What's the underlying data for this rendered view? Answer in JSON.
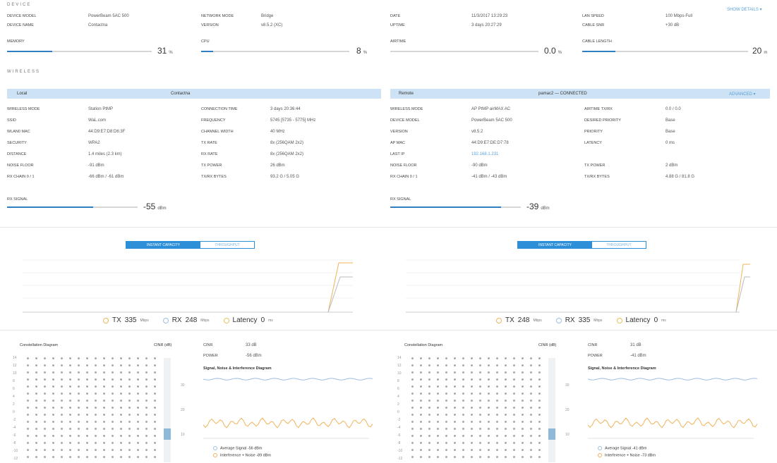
{
  "device": {
    "title": "DEVICE",
    "more_link": "SHOW DETAILS ▾",
    "model_label": "DEVICE MODEL",
    "model_value": "PowerBeam 5AC 500",
    "name_label": "DEVICE NAME",
    "name_value": "Contactna",
    "network_label": "NETWORK MODE",
    "network_value": "Bridge",
    "version_label": "VERSION",
    "version_value": "v8.5.2 (XC)",
    "date_label": "DATE",
    "date_value": "11/3/2017 13:29:23",
    "uptime_label": "UPTIME",
    "uptime_value": "3 days 20:27:29",
    "lan_label": "LAN SPEED",
    "lan_value": "100 Mbps-Full",
    "cable_snr_label": "CABLE SNR",
    "cable_snr_value": "+30 dB",
    "memory_label": "MEMORY",
    "memory_value": "31",
    "memory_unit": "%",
    "memory_fill": 0.31,
    "cpu_label": "CPU",
    "cpu_value": "8",
    "cpu_unit": "%",
    "cpu_fill": 0.08,
    "airtime_label": "AIRTIME",
    "airtime_value": "0.0",
    "airtime_unit": "%",
    "airtime_fill": 0.0,
    "cable_len_label": "CABLE LENGTH",
    "cable_len_value": "20",
    "cable_len_unit": "m",
    "cable_len_fill": 0.2
  },
  "wireless": {
    "title": "WIRELESS",
    "local": {
      "hdr_left": "Local",
      "hdr_right": "Contactna",
      "rows_left": [
        {
          "label": "WIRELESS MODE",
          "value": "Station PtMP"
        },
        {
          "label": "SSID",
          "value": "WaL.com"
        },
        {
          "label": "WLAN0 MAC",
          "value": "44:D9:E7:D8:D6:3F"
        },
        {
          "label": "SECURITY",
          "value": "WPA2"
        },
        {
          "label": "DISTANCE",
          "value": "1.4 miles (2.3 km)"
        },
        {
          "label": "NOISE FLOOR",
          "value": "-91 dBm"
        },
        {
          "label": "RX CHAIN 0 / 1",
          "value": "-66 dBm / -61 dBm"
        }
      ],
      "rows_right": [
        {
          "label": "CONNECTION TIME",
          "value": "3 days 20:36:44"
        },
        {
          "label": "FREQUENCY",
          "value": "5745 [5735 - 5775] MHz"
        },
        {
          "label": "CHANNEL WIDTH",
          "value": "40 MHz"
        },
        {
          "label": "TX RATE",
          "value": "8x (256QAM 2x2)"
        },
        {
          "label": "RX RATE",
          "value": "8x (256QAM 2x2)"
        },
        {
          "label": "TX POWER",
          "value": "26 dBm"
        },
        {
          "label": "TX/RX BYTES",
          "value": "93.2 G / 5.05 G"
        }
      ],
      "signal_label": "RX SIGNAL",
      "signal_value": "-55",
      "signal_unit": "dBm",
      "signal_fill": 0.66
    },
    "remote": {
      "hdr_left": "Remote",
      "hdr_mid": "pamac2 — CONNECTED",
      "hdr_right": "ADVANCED ▾",
      "rows_left": [
        {
          "label": "WIRELESS MODE",
          "value": "AP PtMP airMAX AC"
        },
        {
          "label": "DEVICE MODEL",
          "value": "PowerBeam 5AC 500"
        },
        {
          "label": "VERSION",
          "value": "v8.5.2"
        },
        {
          "label": "AP MAC",
          "value": "44:D9:E7:DE:D7:78"
        },
        {
          "label": "LAST IP",
          "value": "192.168.1.231",
          "link": true
        },
        {
          "label": "NOISE FLOOR",
          "value": "-90 dBm"
        },
        {
          "label": "RX CHAIN 0 / 1",
          "value": "-41 dBm / -43 dBm"
        }
      ],
      "rows_right": [
        {
          "label": "AIRTIME TX/RX",
          "value": "0.0 / 0.0"
        },
        {
          "label": "DESIRED PRIORITY",
          "value": "Base"
        },
        {
          "label": "PRIORITY",
          "value": "Base"
        },
        {
          "label": "LATENCY",
          "value": "0 ms"
        },
        {
          "label": "",
          "value": ""
        },
        {
          "label": "TX POWER",
          "value": "2 dBm"
        },
        {
          "label": "TX/RX BYTES",
          "value": "4.88 G / 81.8 G"
        }
      ],
      "signal_label": "RX SIGNAL",
      "signal_value": "-39",
      "signal_unit": "dBm",
      "signal_fill": 0.85
    }
  },
  "capacity": {
    "toggle_on": "INSTANT CAPACITY",
    "toggle_off": "THROUGHPUT",
    "left": {
      "legend": [
        {
          "name": "TX",
          "value": "335",
          "unit": "Mbps",
          "color": "#f0b35a"
        },
        {
          "name": "RX",
          "value": "248",
          "unit": "Mbps",
          "color": "#9dbde0"
        },
        {
          "name": "Latency",
          "value": "0",
          "unit": "ms",
          "color": "#e3c35a"
        }
      ]
    },
    "right": {
      "legend": [
        {
          "name": "TX",
          "value": "248",
          "unit": "Mbps",
          "color": "#f0b35a"
        },
        {
          "name": "RX",
          "value": "335",
          "unit": "Mbps",
          "color": "#9dbde0"
        },
        {
          "name": "Latency",
          "value": "0",
          "unit": "ms",
          "color": "#e3c35a"
        }
      ]
    }
  },
  "constellation": {
    "left": {
      "title": "Constellation Diagram",
      "cinr_hdr": "CINR (dB)",
      "cinr_label": "CINR",
      "cinr_value": "33 dB",
      "power_label": "POWER",
      "power_value": "-56 dBm",
      "sni_title": "Signal, Noise & Interference Diagram",
      "avg_signal": "Average Signal -56 dBm",
      "interference": "Interference + Noise -89 dBm"
    },
    "right": {
      "title": "Constellation Diagram",
      "cinr_hdr": "CINR (dB)",
      "cinr_label": "CINR",
      "cinr_value": "31 dB",
      "power_label": "POWER",
      "power_value": "-41 dBm",
      "sni_title": "Signal, Noise & Interference Diagram",
      "avg_signal": "Average Signal -41 dBm",
      "interference": "Interference + Noise -73 dBm"
    }
  }
}
